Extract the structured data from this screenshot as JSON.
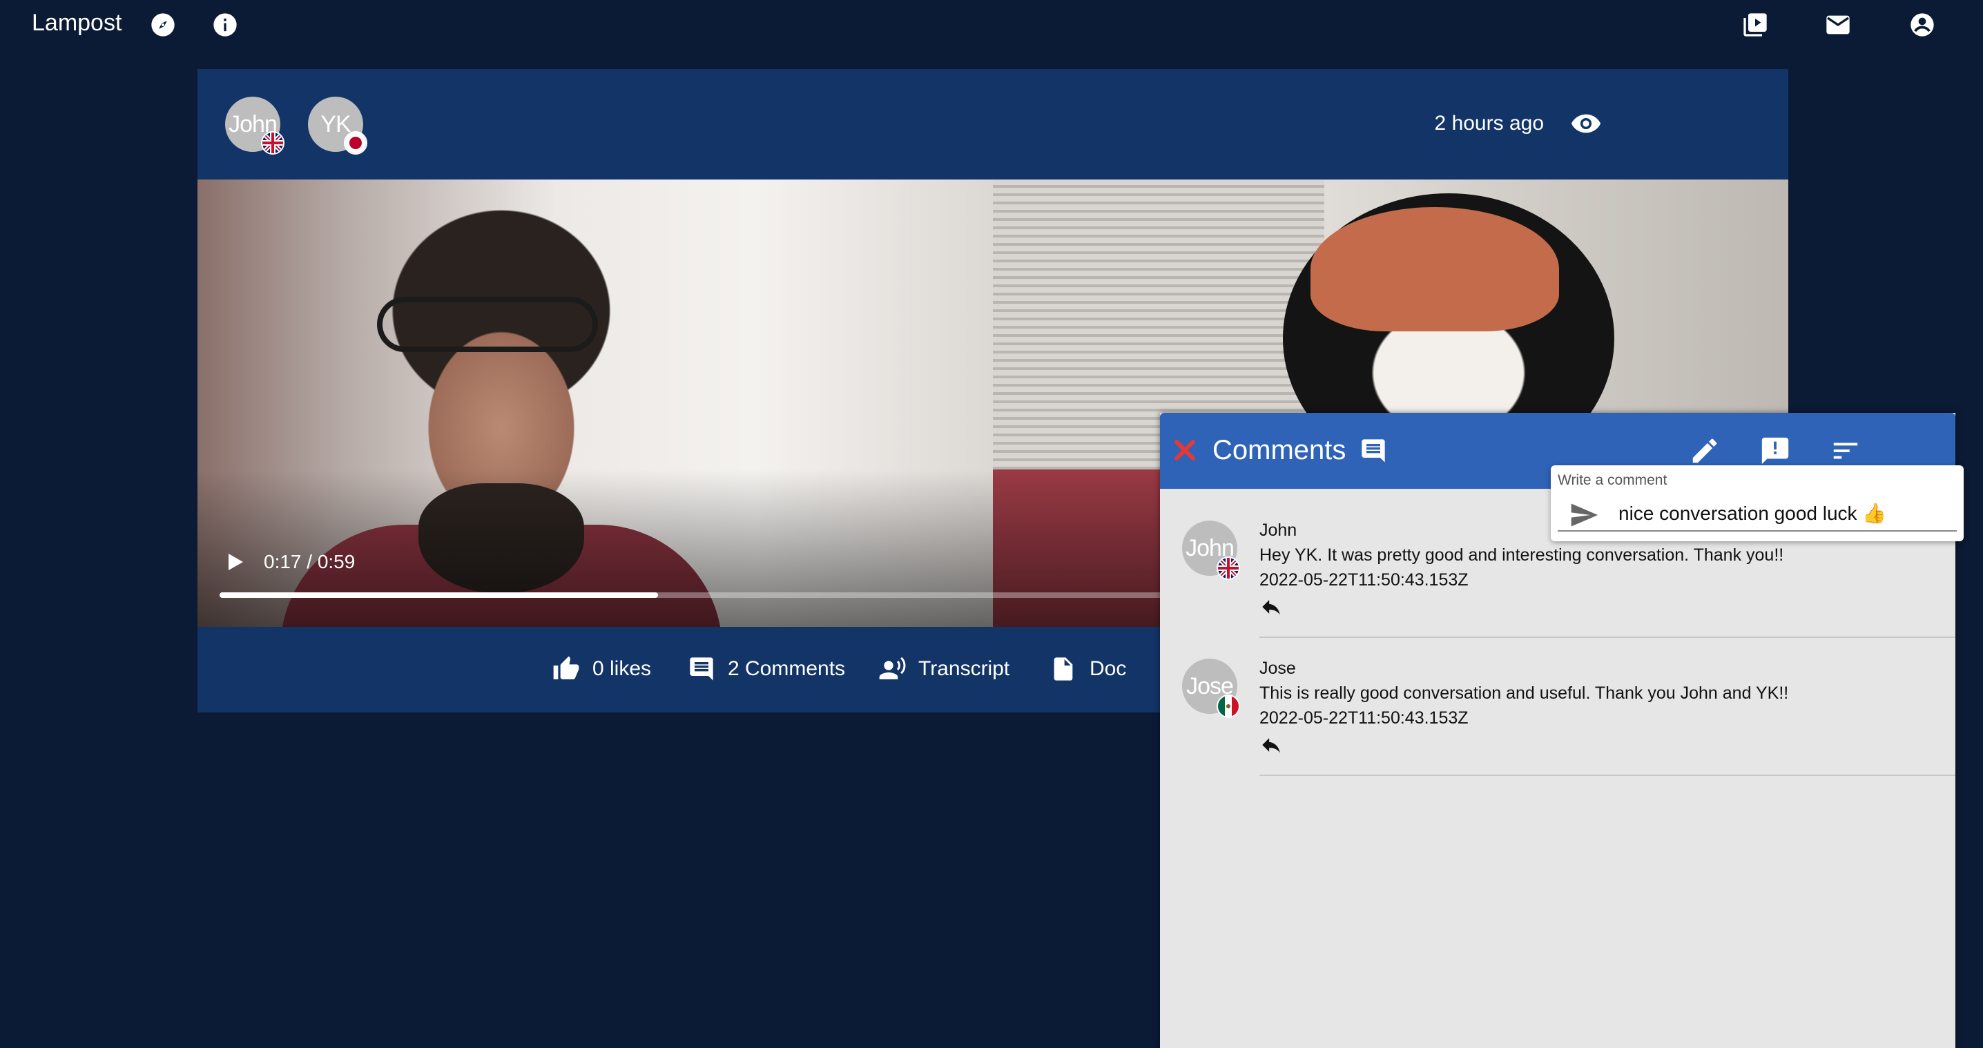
{
  "app": {
    "brand": "Lampost",
    "top_icons": [
      "compass-icon",
      "info-icon",
      "video-library-icon",
      "mail-icon",
      "account-circle-icon"
    ]
  },
  "post": {
    "participants": [
      {
        "initials": "John",
        "flag": "uk-flag-icon"
      },
      {
        "initials": "YK",
        "flag": "japan-flag-icon"
      }
    ],
    "time_ago": "2 hours ago",
    "video": {
      "time": "0:17 / 0:59",
      "progress": 0.2833
    },
    "actions": {
      "likes": "0 likes",
      "comments": "2 Comments",
      "transcript": "Transcript",
      "doc": "Doc"
    }
  },
  "comments_panel": {
    "title": "Comments",
    "write_box": {
      "label": "Write a comment",
      "value": "nice conversation good luck 👍"
    },
    "comments": [
      {
        "avatar": "John",
        "flag": "uk-flag-icon",
        "name": "John",
        "text": "Hey YK. It was pretty good and interesting conversation. Thank you!!",
        "date": "2022-05-22T11:50:43.153Z"
      },
      {
        "avatar": "Jose",
        "flag": "mexico-flag-icon",
        "name": "Jose",
        "text": "This is really good conversation and useful. Thank you John and YK!!",
        "date": "2022-05-22T11:50:43.153Z"
      }
    ]
  },
  "colors": {
    "background": "#0b1a35",
    "card": "#123467",
    "panel_header": "#2f63b8",
    "panel_body": "#e6e6e6",
    "close": "#e53935"
  }
}
